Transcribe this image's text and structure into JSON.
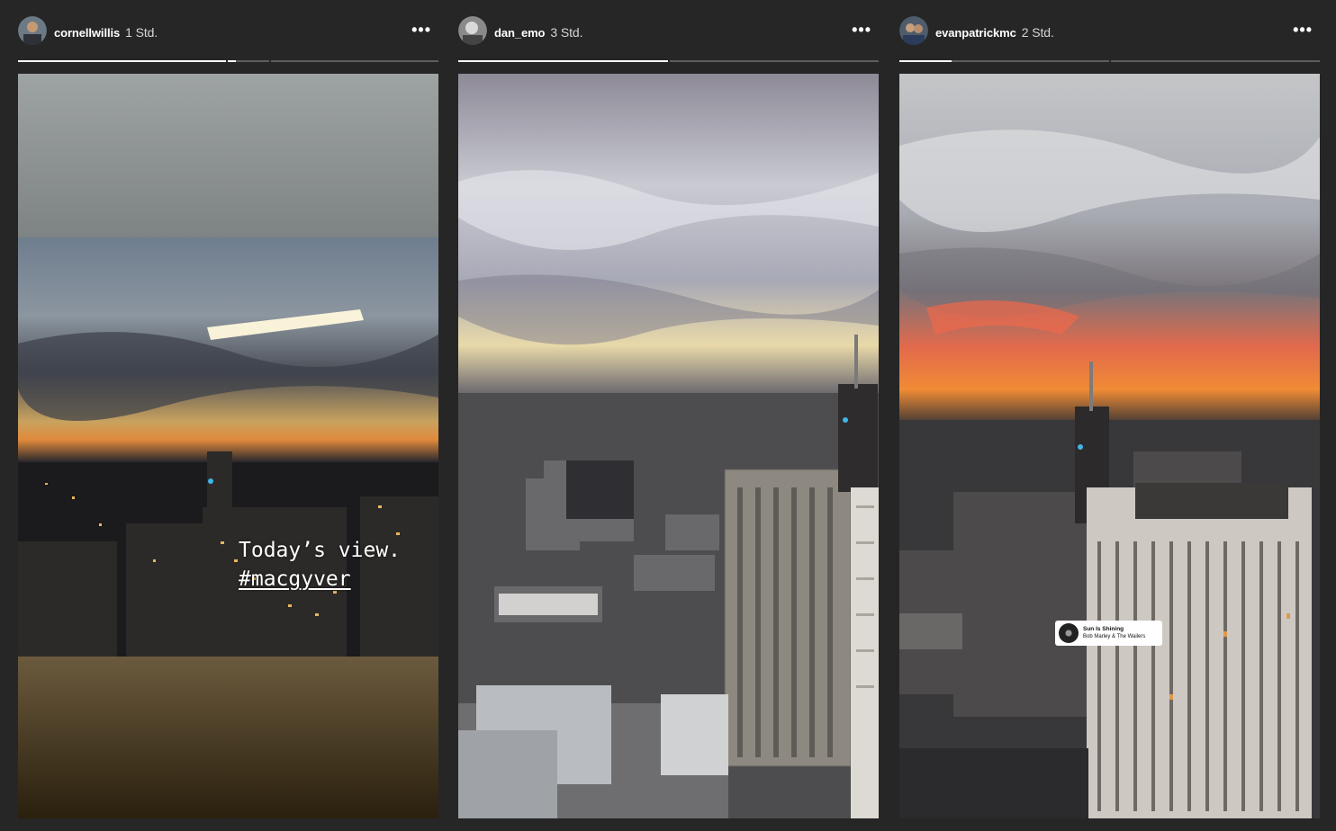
{
  "stories": [
    {
      "username": "cornellwillis",
      "time": "1 Std.",
      "more_label": "•••",
      "caption_line1": "Today’s view.",
      "caption_line2": "#macgyver",
      "progress": [
        1.0,
        0.2,
        0.0
      ]
    },
    {
      "username": "dan_emo",
      "time": "3 Std.",
      "more_label": "•••",
      "progress": [
        1.0,
        0.0
      ]
    },
    {
      "username": "evanpatrickmc",
      "time": "2 Std.",
      "more_label": "•••",
      "progress": [
        0.25,
        0.0
      ]
    }
  ],
  "music_sticker": {
    "song": "Sun Is Shining",
    "artist": "Bob Marley & The Wailers"
  }
}
